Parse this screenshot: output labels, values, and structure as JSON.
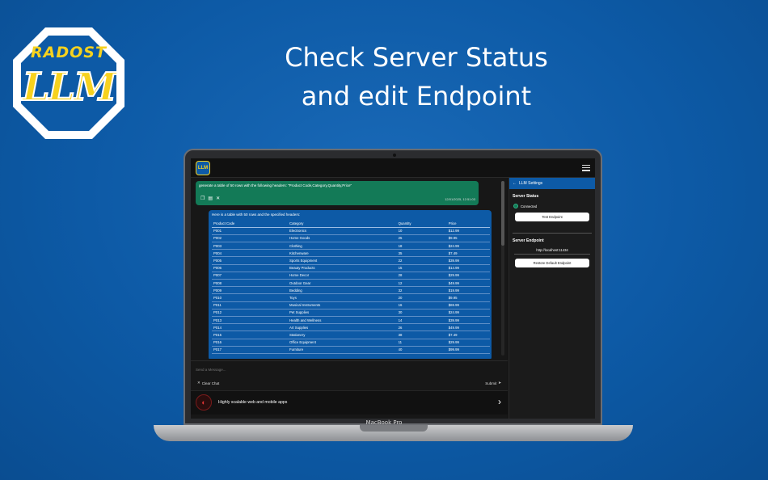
{
  "logo": {
    "top_text": "RADOST",
    "main_text": "LLM"
  },
  "headline": {
    "line1": "Check Server Status",
    "line2": "and edit Endpoint"
  },
  "device": {
    "brand": "MacBook Pro"
  },
  "app": {
    "icon_text": "LLM",
    "chat": {
      "user_message": "generate a table of 50 rows with the following headers: \"Product Code,Category,Quantity,Price\"",
      "user_timestamp": "12/01/2025, 12:51:03",
      "bot_intro": "Here is a table with 50 rows and the specified headers:",
      "table_headers": [
        "Product Code",
        "Category",
        "Quantity",
        "Price"
      ],
      "table_rows": [
        [
          "P001",
          "Electronics",
          "10",
          "$12.99"
        ],
        [
          "P002",
          "Home Goods",
          "25",
          "$9.95"
        ],
        [
          "P003",
          "Clothing",
          "18",
          "$24.99"
        ],
        [
          "P004",
          "Kitchenware",
          "35",
          "$7.49"
        ],
        [
          "P005",
          "Sports Equipment",
          "22",
          "$39.99"
        ],
        [
          "P006",
          "Beauty Products",
          "15",
          "$14.99"
        ],
        [
          "P007",
          "Home Decor",
          "28",
          "$29.99"
        ],
        [
          "P008",
          "Outdoor Gear",
          "12",
          "$49.99"
        ],
        [
          "P009",
          "Bedding",
          "32",
          "$19.99"
        ],
        [
          "P010",
          "Toys",
          "20",
          "$9.95"
        ],
        [
          "P011",
          "Musical Instruments",
          "16",
          "$69.99"
        ],
        [
          "P012",
          "Pet Supplies",
          "30",
          "$24.99"
        ],
        [
          "P013",
          "Health and Wellness",
          "14",
          "$39.99"
        ],
        [
          "P014",
          "Art Supplies",
          "26",
          "$49.99"
        ],
        [
          "P015",
          "Stationery",
          "38",
          "$7.49"
        ],
        [
          "P016",
          "Office Equipment",
          "11",
          "$29.99"
        ],
        [
          "P017",
          "Furniture",
          "40",
          "$99.99"
        ]
      ]
    },
    "composer": {
      "placeholder": "Send a Message...",
      "clear_label": "Clear Chat",
      "submit_label": "Submit"
    },
    "ad": {
      "text": "Highly scalable web and mobile apps"
    },
    "settings": {
      "title": "LLM Settings",
      "server_status_title": "Server Status",
      "status_text": "Connected",
      "status_color": "#137a57",
      "test_button": "Test Endpoint",
      "endpoint_title": "Server Endpoint",
      "endpoint_value": "http://localhost:11434",
      "restore_button": "Restore Default Endpoint"
    }
  },
  "colors": {
    "background": "#0d5aa6",
    "accent_yellow": "#f7d21e",
    "user_bubble": "#137a57",
    "bot_bubble": "#0d5aa6"
  }
}
